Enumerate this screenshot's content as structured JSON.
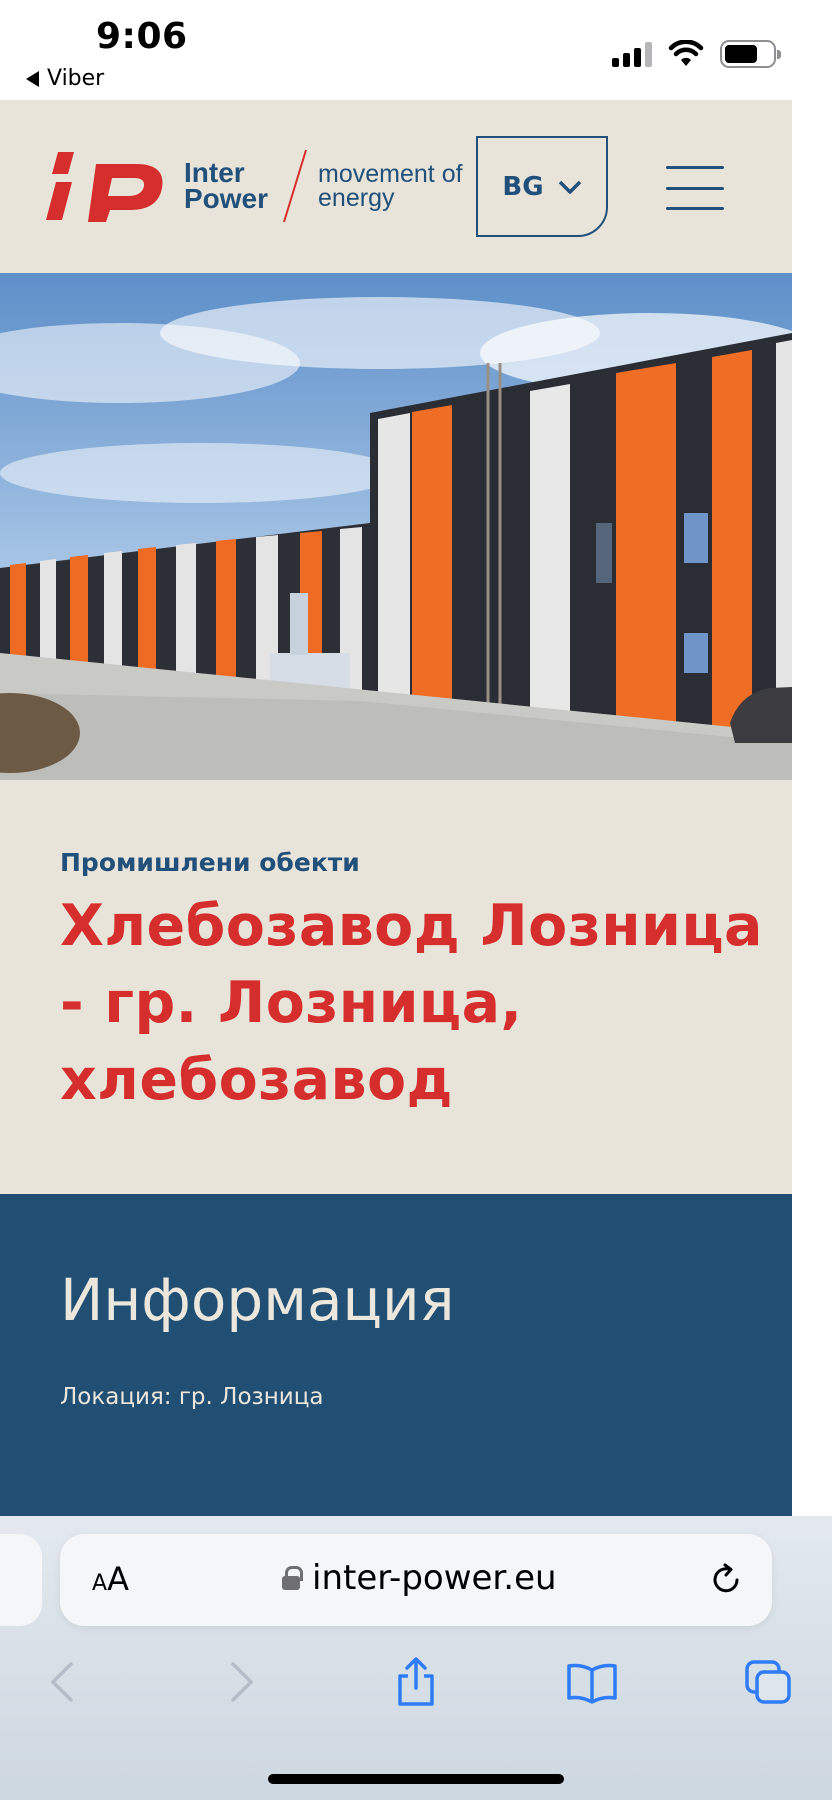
{
  "status_bar": {
    "time": "9:06",
    "back_app": "Viber",
    "icons": [
      "signal-icon",
      "wifi-icon",
      "battery-icon"
    ]
  },
  "header": {
    "logo_name_line1": "Inter",
    "logo_name_line2": "Power",
    "logo_tagline_line1": "movement of",
    "logo_tagline_line2": "energy",
    "language": "BG",
    "icons": [
      "chevron-down-icon",
      "hamburger-menu-icon"
    ]
  },
  "hero": {
    "image": "industrial-building-photo"
  },
  "project": {
    "category": "Промишлени обекти",
    "title": "Хлебозавод Лозница - гр. Лозница, хлебозавод"
  },
  "info": {
    "heading": "Информация",
    "location": "Локация: гр. Лозница"
  },
  "browser": {
    "aa_small": "A",
    "aa_big": "A",
    "url": "inter-power.eu",
    "toolbar_icons": [
      "back-icon",
      "forward-icon",
      "share-icon",
      "bookmarks-icon",
      "tabs-icon"
    ]
  },
  "colors": {
    "brand_red": "#d62d2d",
    "brand_blue": "#21507a",
    "beige": "#e9e4da",
    "info_bg": "#214f74"
  }
}
